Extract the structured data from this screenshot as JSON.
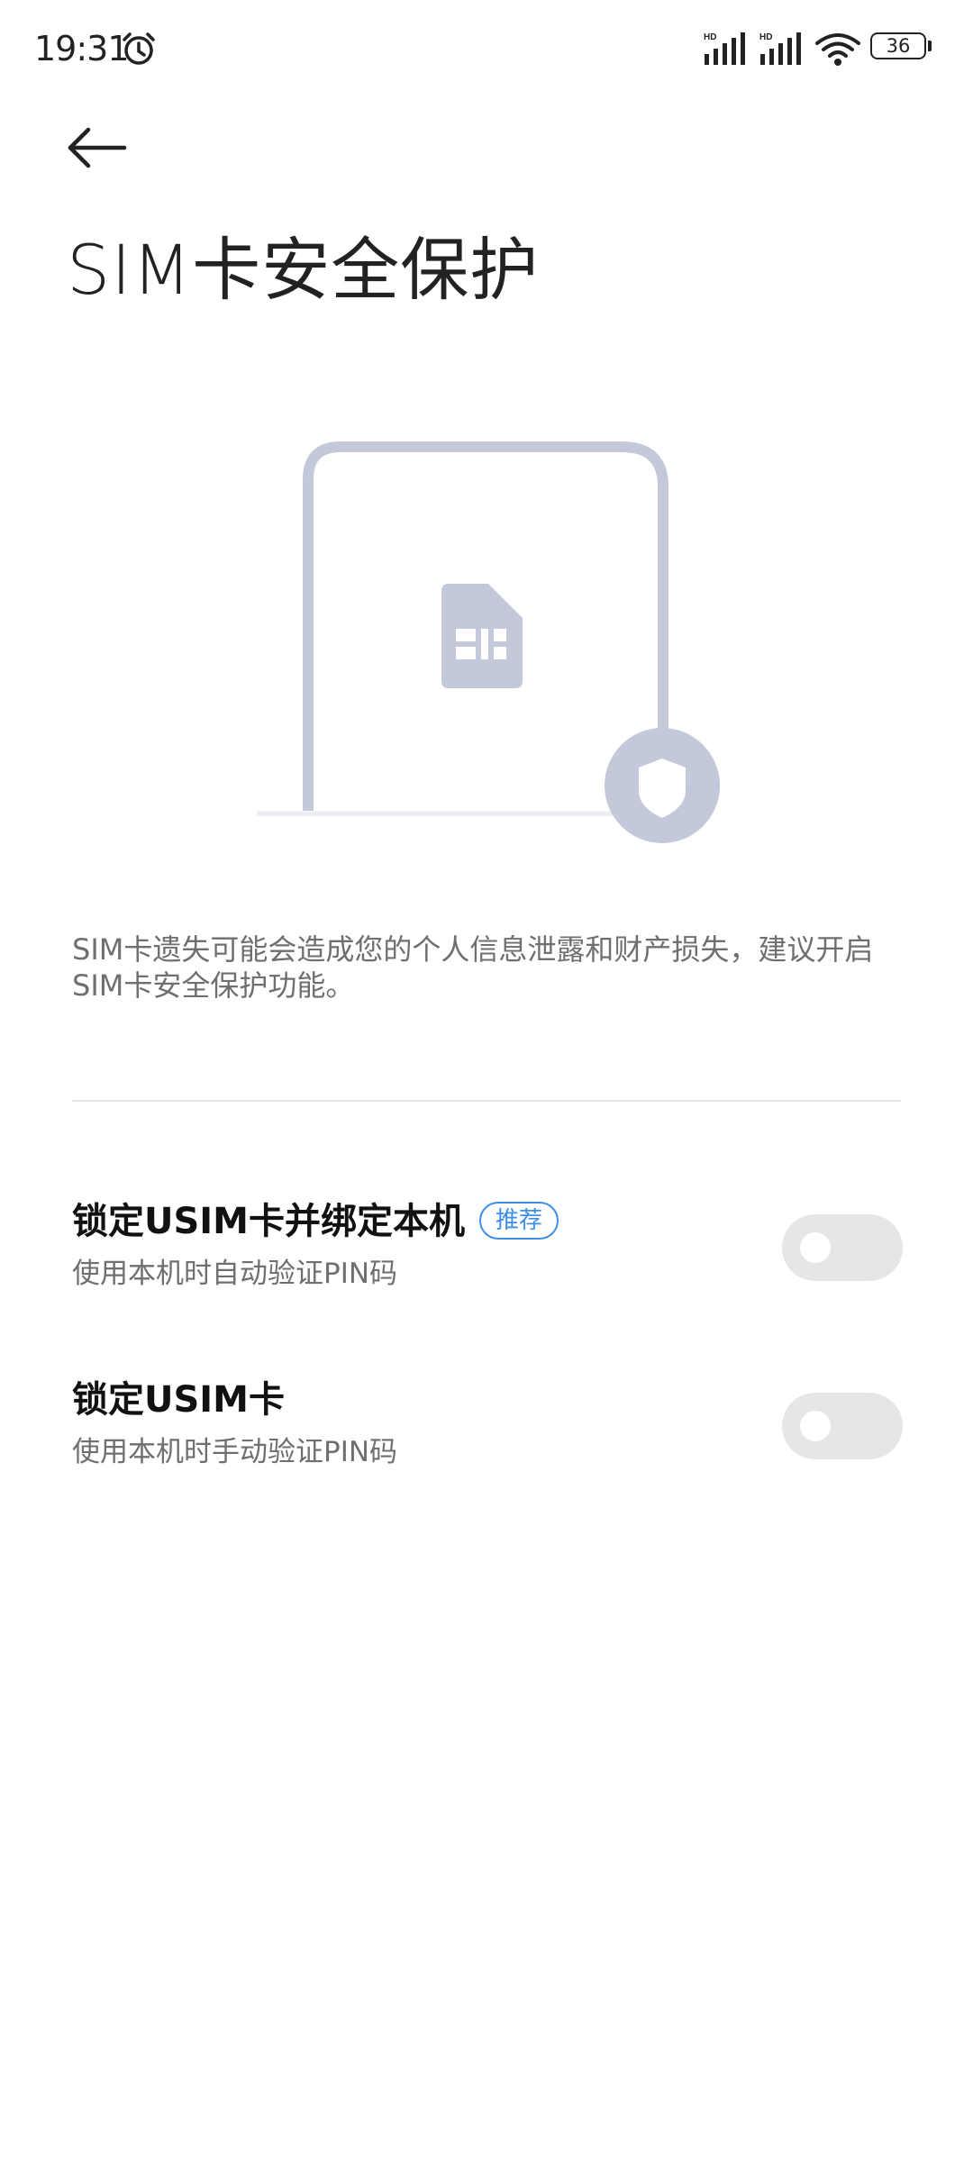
{
  "status_bar": {
    "time": "19:31",
    "sim1_label": "HD",
    "sim2_label": "HD",
    "battery_level": "36",
    "icons": [
      "alarm-icon",
      "signal-icon",
      "signal-icon",
      "wifi-icon",
      "battery-icon"
    ]
  },
  "header": {
    "back_icon": "arrow-left-icon",
    "title": "SIM卡安全保护"
  },
  "illustration": {
    "icons": [
      "sim-card-icon",
      "shield-icon"
    ],
    "colors": {
      "frame": "#c3c8db",
      "baseline": "#eceef3"
    }
  },
  "description": "SIM卡遗失可能会造成您的个人信息泄露和财产损失，建议开启SIM卡安全保护功能。",
  "settings": [
    {
      "title": "锁定USIM卡并绑定本机",
      "badge": "推荐",
      "subtitle": "使用本机时自动验证PIN码",
      "enabled": false
    },
    {
      "title": "锁定USIM卡",
      "subtitle": "使用本机时手动验证PIN码",
      "enabled": false
    }
  ],
  "colors": {
    "accent": "#3d8fe8",
    "toggle_off": "#e6e6e6",
    "secondary_text": "#6f6f6f"
  }
}
